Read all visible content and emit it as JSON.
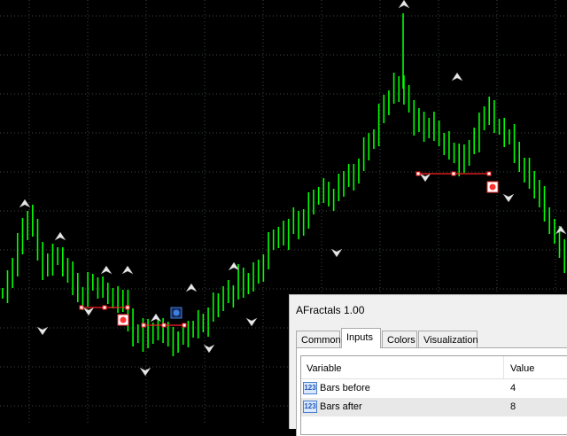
{
  "colors": {
    "background": "#000000",
    "grid": "#3a4a3a",
    "candle": "#00ff00",
    "fractal_up": "#e8e8e8",
    "fractal_down": "#e8e8e8",
    "level_line": "#ff2020",
    "buy_marker": "#3b7fe0",
    "sell_marker": "#ff3030"
  },
  "chart_data": {
    "type": "line",
    "title": "",
    "xlabel": "",
    "ylabel": "",
    "series": [
      {
        "values": [
          331,
          318,
          300,
          279,
          258,
          246,
          258,
          280,
          306,
          300,
          285,
          292,
          300,
          311,
          320,
          332,
          336,
          322,
          320,
          326,
          329,
          331,
          340,
          336,
          343,
          360,
          381,
          374,
          386,
          371,
          376,
          374,
          369,
          382,
          388,
          383,
          381,
          374,
          370,
          365,
          367,
          354,
          344,
          341,
          329,
          336,
          331,
          314,
          324,
          316,
          311,
          304,
          294,
          276,
          269,
          262,
          270,
          256,
          250,
          257,
          244,
          232,
          225,
          218,
          215,
          226,
          219,
          209,
          202,
          201,
          197,
          187,
          170,
          161,
          153,
          131,
          117,
          108,
          95,
          101,
          108,
          121,
          142,
          137,
          148,
          140,
          146,
          156,
          161,
          170,
          178,
          188,
          175,
          166,
          159,
          138,
          127,
          123,
          140,
          146,
          155,
          156,
          172,
          186,
          193,
          204,
          210,
          224,
          244,
          253,
          268,
          279,
          300
        ]
      }
    ],
    "fractal_up_markers": 15,
    "fractal_down_markers": 8
  },
  "dialog": {
    "title": "AFractals 1.00",
    "tabs": [
      {
        "label": "Common"
      },
      {
        "label": "Inputs"
      },
      {
        "label": "Colors"
      },
      {
        "label": "Visualization"
      }
    ],
    "active_tab": "Inputs",
    "table": {
      "headers": {
        "variable": "Variable",
        "value": "Value"
      },
      "rows": [
        {
          "icon": "123",
          "name": "Bars before",
          "value": "4"
        },
        {
          "icon": "123",
          "name": "Bars after",
          "value": "8"
        }
      ]
    }
  }
}
